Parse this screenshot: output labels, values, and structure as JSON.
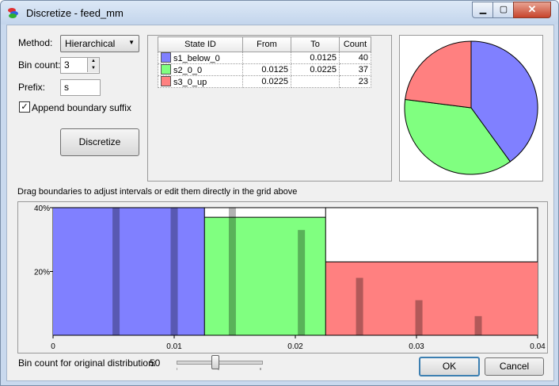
{
  "window": {
    "title": "Discretize - feed_mm"
  },
  "controls": {
    "method_label": "Method:",
    "method_value": "Hierarchical",
    "bin_count_label": "Bin count:",
    "bin_count_value": "3",
    "prefix_label": "Prefix:",
    "prefix_value": "s",
    "append_label": "Append boundary suffix",
    "append_checked": true,
    "discretize_button": "Discretize"
  },
  "grid": {
    "columns": [
      "State ID",
      "From",
      "To",
      "Count"
    ],
    "rows": [
      {
        "id": "s1_below_0",
        "from": "",
        "to": "0.0125",
        "count": "40",
        "color": "#8080ff"
      },
      {
        "id": "s2_0_0",
        "from": "0.0125",
        "to": "0.0225",
        "count": "37",
        "color": "#80ff80"
      },
      {
        "id": "s3_0_up",
        "from": "0.0225",
        "to": "",
        "count": "23",
        "color": "#ff8080"
      }
    ]
  },
  "hint": "Drag boundaries to adjust intervals or edit them directly in the grid above",
  "footer": {
    "bin_count_label": "Bin count for original distribution:",
    "bin_count_value": "50",
    "ok": "OK",
    "cancel": "Cancel"
  },
  "chart_data": [
    {
      "type": "pie",
      "categories": [
        "s1_below_0",
        "s2_0_0",
        "s3_0_up"
      ],
      "values": [
        40,
        37,
        23
      ],
      "colors": [
        "#8080ff",
        "#80ff80",
        "#ff8080"
      ]
    },
    {
      "type": "bar",
      "title": "",
      "xlabel": "",
      "ylabel": "",
      "xlim": [
        0,
        0.04
      ],
      "ylim": [
        0,
        40
      ],
      "xticks": [
        "0",
        "0.01",
        "0.02",
        "0.03",
        "0.04"
      ],
      "yticks": [
        "20%",
        "40%"
      ],
      "intervals": [
        {
          "from": 0,
          "to": 0.0125,
          "percent": 40,
          "color": "#8080ff"
        },
        {
          "from": 0.0125,
          "to": 0.0225,
          "percent": 37,
          "color": "#80ff80"
        },
        {
          "from": 0.0225,
          "to": 0.04,
          "percent": 23,
          "color": "#ff8080"
        }
      ],
      "original_bars": [
        {
          "x": 0.0052,
          "percent": 40
        },
        {
          "x": 0.01,
          "percent": 40
        },
        {
          "x": 0.0148,
          "percent": 40
        },
        {
          "x": 0.0205,
          "percent": 33
        },
        {
          "x": 0.0253,
          "percent": 18
        },
        {
          "x": 0.0302,
          "percent": 11
        },
        {
          "x": 0.0351,
          "percent": 6
        }
      ]
    }
  ]
}
